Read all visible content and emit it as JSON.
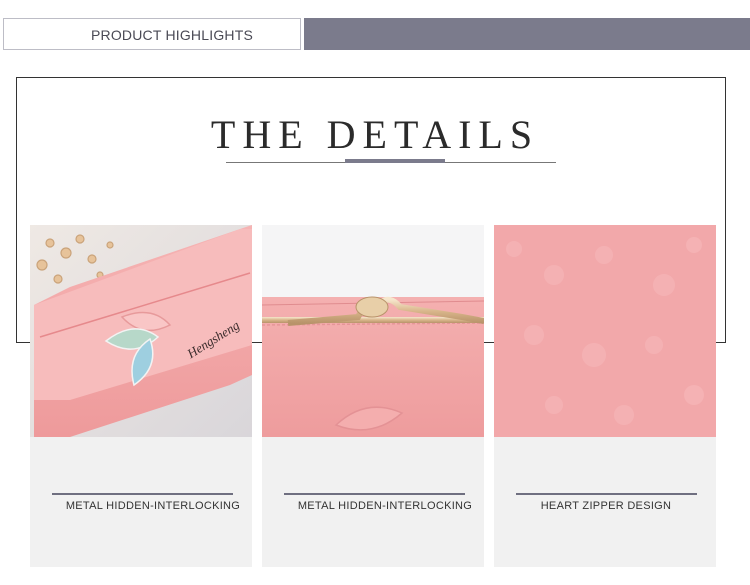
{
  "header": {
    "label": "PRODUCT HIGHLIGHTS"
  },
  "section": {
    "title": "THE DETAILS"
  },
  "features": [
    {
      "caption": "METAL HIDDEN-INTERLOCKING"
    },
    {
      "caption": "METAL HIDDEN-INTERLOCKING"
    },
    {
      "caption": "HEART ZIPPER DESIGN"
    }
  ],
  "photo1": {
    "brand_script": "Hengsheng"
  },
  "colors": {
    "accent": "#7b7b8c",
    "product_pink": "#f2a8aa",
    "leaf_green": "#b7d8c9",
    "leaf_blue": "#9ecfe0"
  }
}
